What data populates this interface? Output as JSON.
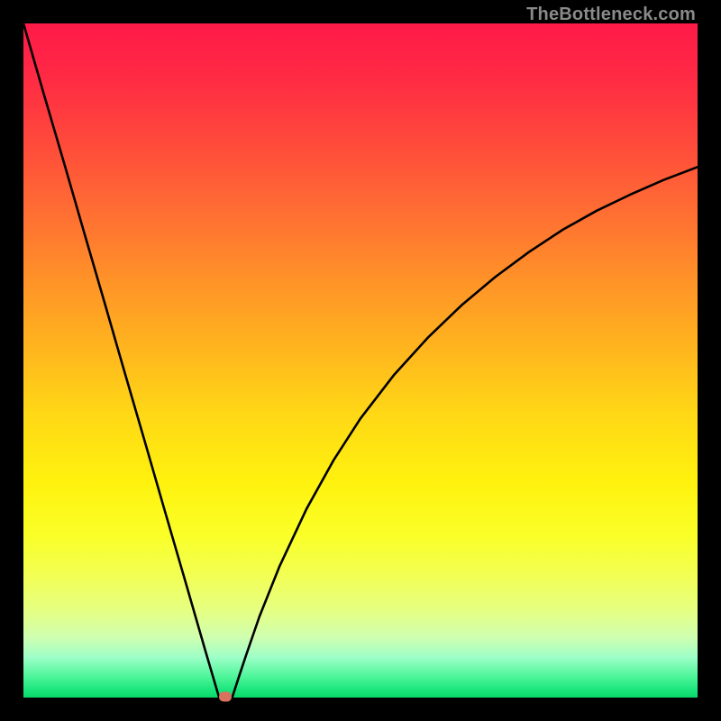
{
  "watermark": "TheBottleneck.com",
  "colors": {
    "background": "#000000",
    "curve": "#000000",
    "marker": "#d9715f",
    "gradient_top": "#ff1a48",
    "gradient_bottom": "#0ad968"
  },
  "chart_data": {
    "type": "line",
    "title": "",
    "xlabel": "",
    "ylabel": "",
    "xlim": [
      0,
      100
    ],
    "ylim": [
      0,
      100
    ],
    "grid": false,
    "legend": false,
    "series": [
      {
        "name": "bottleneck-curve",
        "x": [
          0,
          3,
          6,
          9,
          12,
          15,
          18,
          21,
          24,
          27,
          28,
          29,
          30,
          31,
          32,
          33,
          35,
          38,
          42,
          46,
          50,
          55,
          60,
          65,
          70,
          75,
          80,
          85,
          90,
          95,
          100
        ],
        "values": [
          100,
          89.6,
          79.4,
          69.0,
          58.7,
          48.3,
          38.0,
          27.6,
          17.3,
          6.9,
          3.5,
          0.1,
          0.1,
          0.1,
          3.2,
          6.2,
          12.0,
          19.5,
          28.0,
          35.2,
          41.4,
          47.9,
          53.4,
          58.2,
          62.4,
          66.1,
          69.4,
          72.2,
          74.6,
          76.8,
          78.7
        ]
      }
    ],
    "annotations": [
      {
        "name": "min-marker",
        "x": 30,
        "y": 0.1
      }
    ]
  }
}
